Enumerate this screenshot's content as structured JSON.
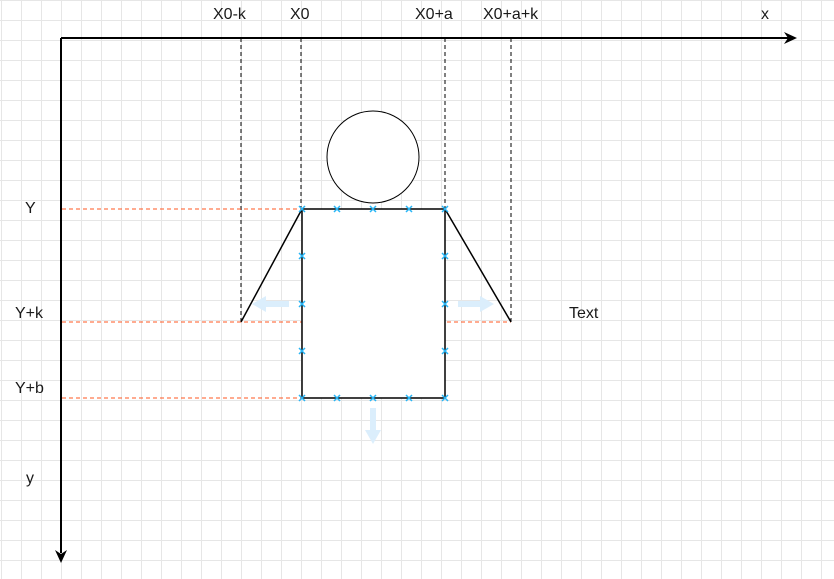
{
  "axes": {
    "x_label": "x",
    "y_label": "y"
  },
  "x_markers": [
    "X0-k",
    "X0",
    "X0+a",
    "X0+a+k"
  ],
  "y_markers": [
    "Y",
    "Y+k",
    "Y+b"
  ],
  "free_text": "Text",
  "colors": {
    "axis": "#000000",
    "guide_vertical": "#000000",
    "guide_horizontal": "#ff5722",
    "selection_handle": "#29b6f6",
    "resize_arrow": "#dbeefc",
    "grid": "#e6e6e6"
  },
  "icons": [
    "selection-handle-icon",
    "resize-arrow-icon"
  ]
}
